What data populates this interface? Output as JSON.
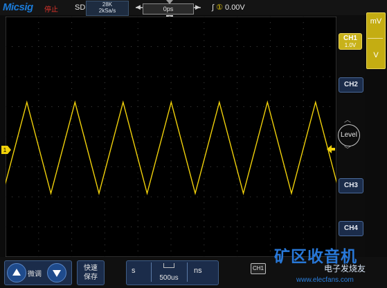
{
  "topbar": {
    "logo": "Micsig",
    "run_state": "停止",
    "mode": "SD",
    "memory_depth": "28K",
    "sample_rate": "2kSa/s",
    "trigger_position": "0ps",
    "trigger_edge_icon": "rising-edge-icon",
    "trigger_source": "①",
    "trigger_level": "0.00V"
  },
  "waveform": {
    "channel_marker": "1",
    "color": "#f1d10a",
    "cycles": 7
  },
  "right_panel": {
    "ch1": "CH1",
    "ch1_scale": "1.0V",
    "ch2": "CH2",
    "ch3": "CH3",
    "ch4": "CH4",
    "level": "Level",
    "unit_mv": "mV",
    "unit_v": "V"
  },
  "bottombar": {
    "fine_label": "微调",
    "save_label_1": "快速",
    "save_label_2": "保存",
    "timebase_unit_left": "s",
    "timebase_value": "500us",
    "timebase_unit_right": "ns",
    "channel_tag": "CH1"
  },
  "watermark": {
    "title": "矿区收音机",
    "subtitle": "电子发烧友",
    "site": "www.elecfans.com"
  },
  "colors": {
    "accent": "#1b2c4a",
    "ch1": "#f1d10a",
    "grid": "#3a3a3a"
  }
}
